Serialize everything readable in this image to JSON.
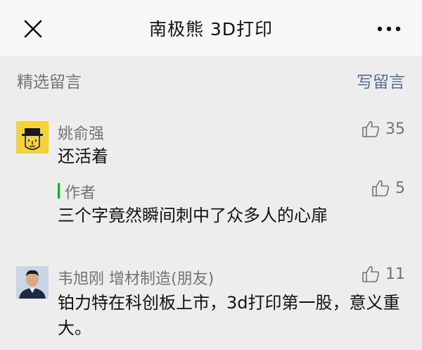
{
  "topbar": {
    "title": "南极熊 3D打印",
    "close_icon": "close-icon",
    "more_icon": "more-dots-icon"
  },
  "section": {
    "title": "精选留言",
    "write_label": "写留言"
  },
  "comments": [
    {
      "nickname": "姚俞强",
      "likes": "35",
      "content": "还活着",
      "avatar_icon": "cartoon-hat-avatar",
      "reply": {
        "author_label": "作者",
        "likes": "5",
        "content": "三个字竟然瞬间刺中了众多人的心扉"
      }
    },
    {
      "nickname": "韦旭刚 增材制造(朋友)",
      "likes": "11",
      "content": "铂力特在科创板上市，3d打印第一股，意义重大。",
      "avatar_icon": "person-photo-avatar"
    }
  ],
  "colors": {
    "link_blue": "#576b95",
    "author_green": "#1aad19",
    "meta_gray": "#737373",
    "background": "#ededed"
  }
}
